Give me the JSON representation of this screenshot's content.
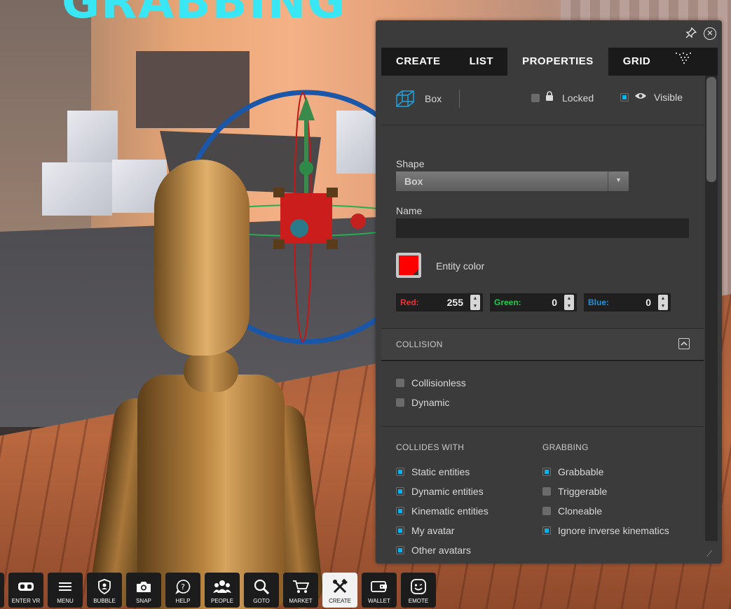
{
  "scene": {
    "sign_text": "GRABBING"
  },
  "panel": {
    "tabs": [
      "CREATE",
      "LIST",
      "PROPERTIES",
      "GRID"
    ],
    "active_tab": "PROPERTIES",
    "entity": {
      "type": "Box",
      "locked_label": "Locked",
      "locked": false,
      "visible_label": "Visible",
      "visible": true
    },
    "shape": {
      "label": "Shape",
      "value": "Box"
    },
    "name": {
      "label": "Name",
      "value": ""
    },
    "color": {
      "label": "Entity color",
      "swatch": "#ff0000",
      "red_label": "Red:",
      "red": "255",
      "green_label": "Green:",
      "green": "0",
      "blue_label": "Blue:",
      "blue": "0"
    },
    "collision": {
      "header": "COLLISION",
      "collisionless_label": "Collisionless",
      "collisionless": false,
      "dynamic_label": "Dynamic",
      "dynamic": false
    },
    "collides_with": {
      "header": "COLLIDES WITH",
      "items": [
        {
          "label": "Static entities",
          "checked": true
        },
        {
          "label": "Dynamic entities",
          "checked": true
        },
        {
          "label": "Kinematic entities",
          "checked": true
        },
        {
          "label": "My avatar",
          "checked": true
        },
        {
          "label": "Other avatars",
          "checked": true
        }
      ]
    },
    "grabbing": {
      "header": "GRABBING",
      "items": [
        {
          "label": "Grabbable",
          "checked": true
        },
        {
          "label": "Triggerable",
          "checked": false
        },
        {
          "label": "Cloneable",
          "checked": false
        },
        {
          "label": "Ignore inverse kinematics",
          "checked": true
        }
      ]
    }
  },
  "toolbar": {
    "buttons": [
      {
        "label": "ENTER VR",
        "icon": "vr-headset-icon"
      },
      {
        "label": "MENU",
        "icon": "menu-icon"
      },
      {
        "label": "BUBBLE",
        "icon": "shield-icon"
      },
      {
        "label": "SNAP",
        "icon": "camera-icon"
      },
      {
        "label": "HELP",
        "icon": "help-icon"
      },
      {
        "label": "PEOPLE",
        "icon": "people-icon"
      },
      {
        "label": "GOTO",
        "icon": "search-icon"
      },
      {
        "label": "MARKET",
        "icon": "cart-icon"
      },
      {
        "label": "CREATE",
        "icon": "create-tools-icon"
      },
      {
        "label": "WALLET",
        "icon": "wallet-icon"
      },
      {
        "label": "EMOTE",
        "icon": "emote-icon"
      }
    ],
    "active": "CREATE"
  },
  "colors": {
    "accent": "#00b4ef",
    "red_label": "#e0363a",
    "green_label": "#1fc754",
    "blue_label": "#1e90d6",
    "panel_bg": "#3b3b3b",
    "tab_bar": "#1a1a1a"
  }
}
